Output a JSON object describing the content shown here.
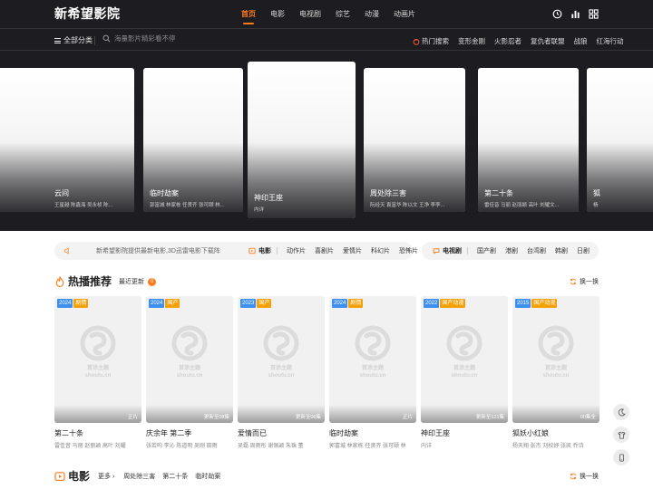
{
  "site": {
    "name": "新希望影院"
  },
  "nav": {
    "items": [
      {
        "label": "首页",
        "active": true
      },
      {
        "label": "电影"
      },
      {
        "label": "电视剧"
      },
      {
        "label": "综艺"
      },
      {
        "label": "动漫"
      },
      {
        "label": "动画片"
      }
    ]
  },
  "top_icons": [
    "clock-icon",
    "chart-bars-icon",
    "grid-icon"
  ],
  "subbar": {
    "all_categories": "全部分类",
    "search_placeholder": "海量影片精彩看不停",
    "hot_label": "热门搜索",
    "hot_keywords": [
      "变形金刚",
      "火影忍者",
      "复仇者联盟",
      "战狼",
      "红海行动"
    ]
  },
  "slides": [
    {
      "title": "云间",
      "cast": "王星越 陈鑫海 吴永桢 陈..."
    },
    {
      "title": "临时劫案",
      "cast": "郭富城 林家栋 任贤齐 张可颐 林..."
    },
    {
      "title": "神印王座",
      "cast": "内详"
    },
    {
      "title": "周处除三害",
      "cast": "阮经天 袁富华 陈以文 王净 李李..."
    },
    {
      "title": "第二十条",
      "cast": "雷佳音 马丽 赵丽颖 高叶 刘耀文..."
    },
    {
      "title": "狐",
      "cast": "杨"
    }
  ],
  "notice": {
    "text": "新希望影院提供最新电影,3D迅雷电影下载阵"
  },
  "movie_cats": {
    "head": "电影",
    "items": [
      "动作片",
      "喜剧片",
      "爱情片",
      "科幻片",
      "恐怖片"
    ]
  },
  "tv_cats": {
    "head": "电视剧",
    "items": [
      "国产剧",
      "港剧",
      "台湾剧",
      "韩剧",
      "日剧"
    ]
  },
  "hot_section": {
    "title": "热播推荐",
    "recent_label": "最近更新",
    "recent_count": "0",
    "swap": "换一换",
    "cards": [
      {
        "year": "2024",
        "genre": "剧情",
        "status": "正片",
        "title": "第二十条",
        "cast": "雷佳音 马丽 赵丽颖 高叶 刘耀"
      },
      {
        "year": "2024",
        "genre": "国产",
        "status": "更新至08集",
        "title": "庆余年 第二季",
        "cast": "张若昀 李沁 陈道明 吴刚 田雨"
      },
      {
        "year": "2023",
        "genre": "国产",
        "status": "更新至06集",
        "title": "爱情而已",
        "cast": "吴磊 周雨彤 谢佩颖 朱珠 董"
      },
      {
        "year": "2024",
        "genre": "剧情",
        "status": "正片",
        "title": "临时劫案",
        "cast": "郭富城 林家栋 任贤齐 张可颐 林"
      },
      {
        "year": "2022",
        "genre": "国产动漫",
        "status": "更新至121集",
        "title": "神印王座",
        "cast": "内详"
      },
      {
        "year": "2015",
        "genre": "国产动漫",
        "status": "00集全",
        "title": "狐妖小红娘",
        "cast": "杨天翔 张杰 刘校妤 张凯 乔诗"
      }
    ]
  },
  "movie_section": {
    "title": "电影",
    "more": "更多",
    "links": [
      "周处除三害",
      "第二十条",
      "临时劫案"
    ],
    "swap": "换一换"
  },
  "watermark": {
    "line1": "首涂主题",
    "line2": "shoutu.cn"
  },
  "float_buttons": [
    "moon-icon",
    "tshirt-icon",
    "phone-icon"
  ],
  "colors": {
    "accent": "#ff7a1a",
    "dark_bg": "#1d1d21",
    "year_tag": "#3d8ff0",
    "genre_tag": "#f5a10a"
  }
}
